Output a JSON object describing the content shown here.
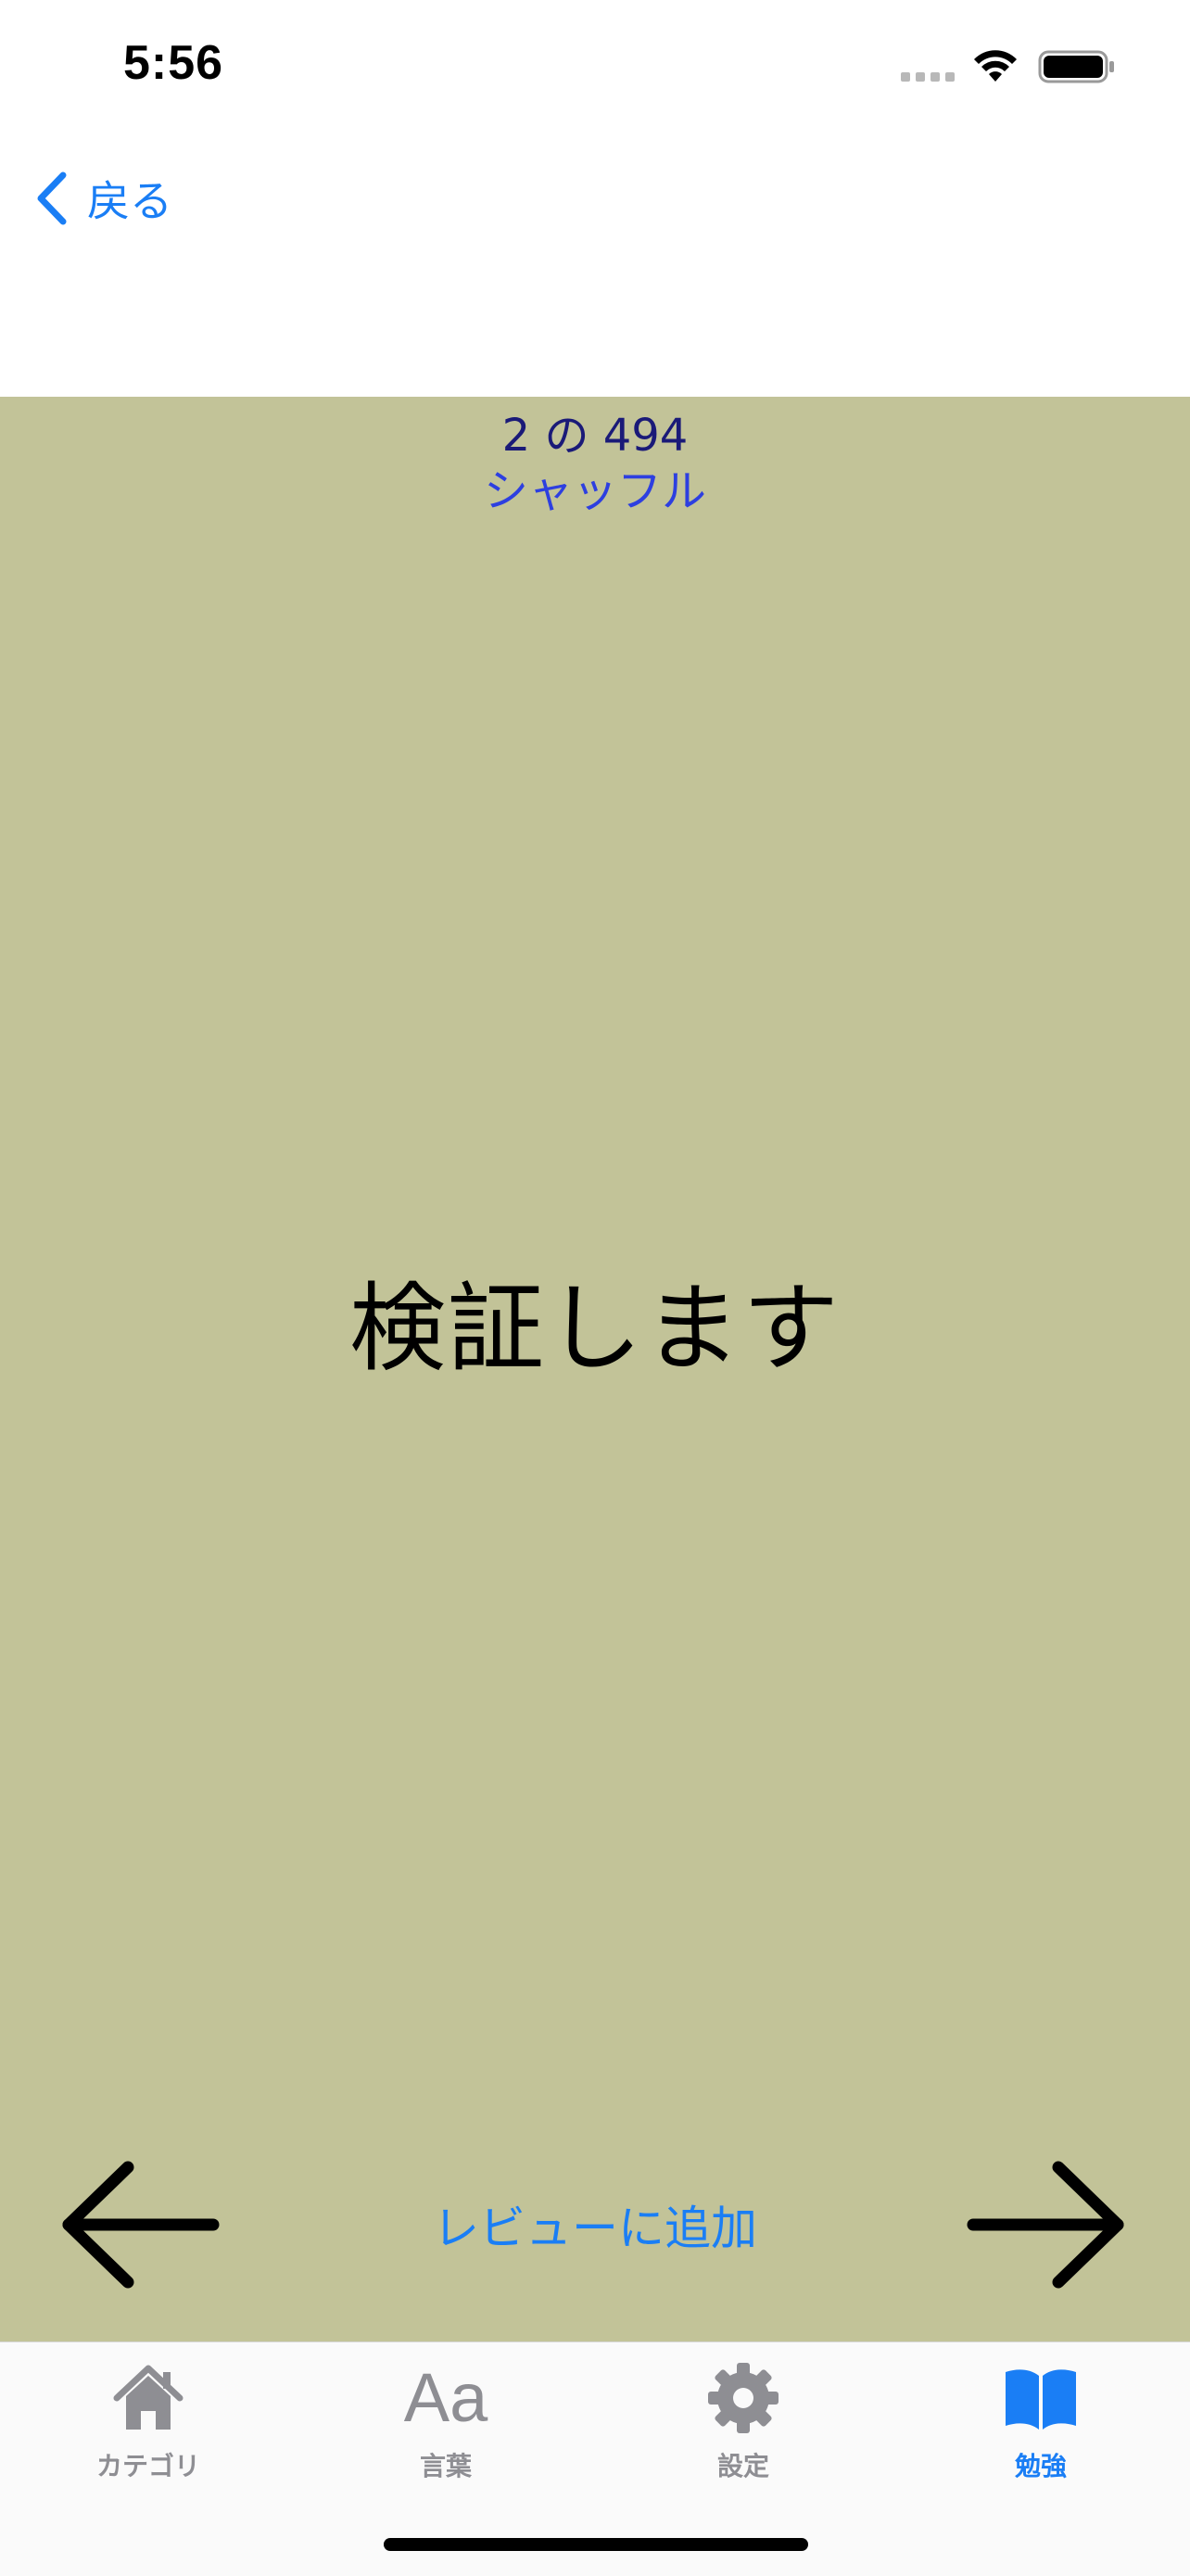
{
  "status_bar": {
    "time": "5:56"
  },
  "nav": {
    "back_label": "戻る"
  },
  "card": {
    "counter": "2 の 494",
    "shuffle_label": "シャッフル",
    "word": "検証します",
    "add_review_label": "レビューに追加",
    "background_color": "#c2c398"
  },
  "tab_bar": {
    "tabs": [
      {
        "label": "カテゴリ",
        "icon": "house-icon",
        "active": false
      },
      {
        "label": "言葉",
        "icon": "text-aa-icon",
        "icon_text": "Aa",
        "active": false
      },
      {
        "label": "設定",
        "icon": "gear-icon",
        "active": false
      },
      {
        "label": "勉強",
        "icon": "book-icon",
        "active": true
      }
    ]
  },
  "colors": {
    "accent": "#1a7ef5",
    "inactive": "#8e8e93"
  }
}
